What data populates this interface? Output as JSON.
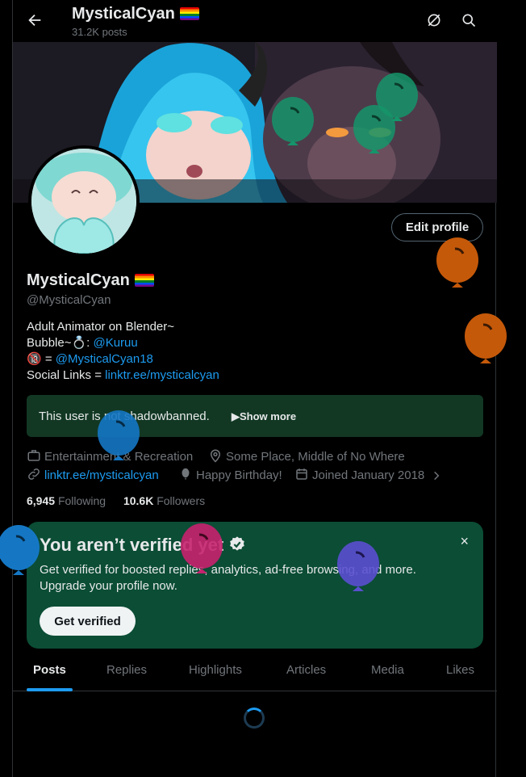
{
  "header": {
    "display_name": "MysticalCyan",
    "post_count": "31.2K posts"
  },
  "profile": {
    "display_name": "MysticalCyan",
    "handle": "@MysticalCyan",
    "edit_label": "Edit profile",
    "bio": {
      "line1": "Adult Animator on Blender~",
      "line2_prefix": "Bubble~💍: ",
      "line2_link": "@Kuruu",
      "line3_prefix": "🔞 = ",
      "line3_link": "@MysticalCyan18",
      "line4_prefix": "Social Links = ",
      "line4_link": "linktr.ee/mysticalcyan"
    },
    "shadowban": {
      "text": "This user is not shadowbanned.",
      "more": "Show more"
    },
    "meta": {
      "category": "Entertainment & Recreation",
      "location": "Some Place, Middle of No Where",
      "website": "linktr.ee/mysticalcyan",
      "birthday": "Happy Birthday!",
      "joined": "Joined January 2018"
    },
    "following_count": "6,945",
    "following_label": "Following",
    "followers_count": "10.6K",
    "followers_label": "Followers"
  },
  "verify": {
    "title": "You aren’t verified yet",
    "description": "Get verified for boosted replies, analytics, ad-free browsing, and more. Upgrade your profile now.",
    "button": "Get verified",
    "close": "×"
  },
  "tabs": [
    "Posts",
    "Replies",
    "Highlights",
    "Articles",
    "Media",
    "Likes"
  ],
  "colors": {
    "accent": "#1d9bf0",
    "verify_bg": "#0b4d35",
    "shadowbox_bg": "#123824"
  },
  "icons": [
    "back-arrow-icon",
    "grok-icon",
    "search-icon",
    "briefcase-icon",
    "location-pin-icon",
    "link-icon",
    "balloon-icon",
    "calendar-icon",
    "chevron-right-icon",
    "verified-badge-icon",
    "close-icon"
  ]
}
